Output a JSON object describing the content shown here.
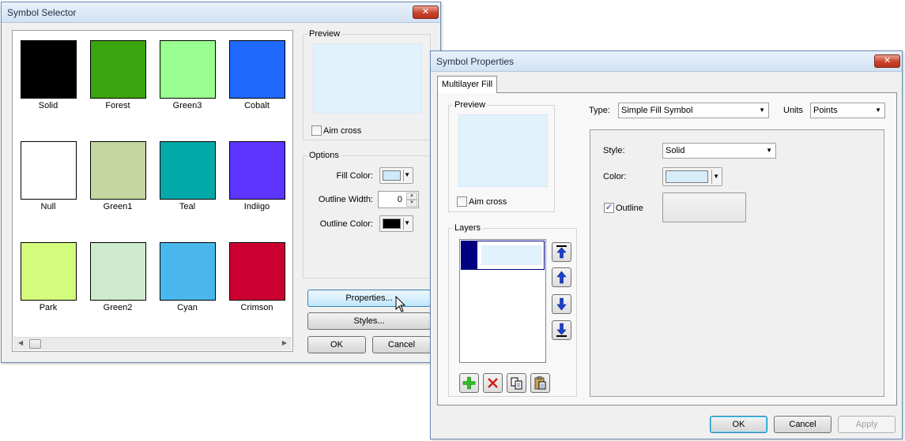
{
  "selector": {
    "title": "Symbol Selector",
    "close_glyph": "✕",
    "symbols": [
      {
        "name": "Solid",
        "color": "#000000"
      },
      {
        "name": "Forest",
        "color": "#3aa50e"
      },
      {
        "name": "Green3",
        "color": "#99ff90"
      },
      {
        "name": "Cobalt",
        "color": "#1f69ff"
      },
      {
        "name": "Null",
        "color": "#ffffff"
      },
      {
        "name": "Green1",
        "color": "#c5d6a0"
      },
      {
        "name": "Teal",
        "color": "#01a9a8"
      },
      {
        "name": "Indiigo",
        "color": "#5d35ff"
      },
      {
        "name": "Park",
        "color": "#d4fc7c"
      },
      {
        "name": "Green2",
        "color": "#cfebcd"
      },
      {
        "name": "Cyan",
        "color": "#4ab7ec"
      },
      {
        "name": "Crimson",
        "color": "#cb0030"
      }
    ],
    "preview_label": "Preview",
    "preview_color": "#e2f2fc",
    "aim_cross_label": "Aim cross",
    "options_label": "Options",
    "fill_color_label": "Fill Color:",
    "fill_color": "#cfe9fa",
    "outline_width_label": "Outline Width:",
    "outline_width": "0",
    "outline_color_label": "Outline Color:",
    "outline_color": "#000000",
    "properties_label": "Properties...",
    "styles_label": "Styles...",
    "ok_label": "OK",
    "cancel_label": "Cancel"
  },
  "properties": {
    "title": "Symbol Properties",
    "close_glyph": "✕",
    "tab_label": "Multilayer Fill",
    "preview_label": "Preview",
    "preview_color": "#e2f2fc",
    "aim_cross_label": "Aim cross",
    "layers_label": "Layers",
    "layer_highlight_color": "#000080",
    "type_label": "Type:",
    "type_value": "Simple Fill Symbol",
    "units_label": "Units",
    "units_value": "Points",
    "style_label": "Style:",
    "style_value": "Solid",
    "color_label": "Color:",
    "color_value": "#d8ecfa",
    "outline_label": "Outline",
    "outline_checked": "✓",
    "ok_label": "OK",
    "cancel_label": "Cancel",
    "apply_label": "Apply"
  }
}
